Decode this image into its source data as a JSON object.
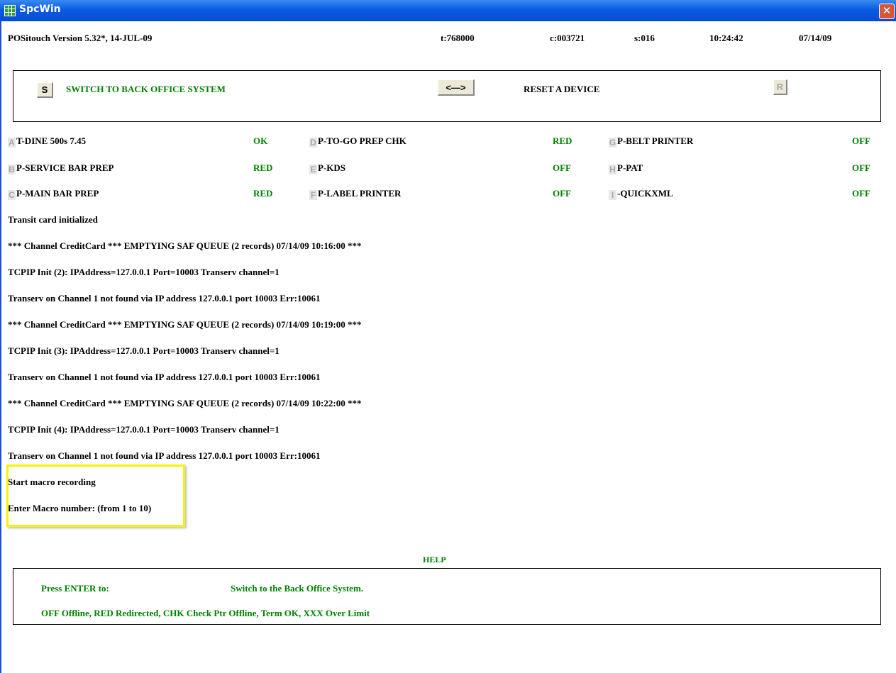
{
  "window": {
    "title": "SpcWin",
    "close": "✕"
  },
  "status": {
    "version": "POSitouch Version 5.32*, 14-JUL-09",
    "t": "t:768000",
    "c": "c:003721",
    "s": "s:016",
    "time": "10:24:42",
    "date": "07/14/09"
  },
  "top_actions": {
    "s_key": "S",
    "switch_label": "SWITCH TO BACK OFFICE SYSTEM",
    "arrow_key": "<—>",
    "reset_label": "RESET A DEVICE",
    "r_key": "R"
  },
  "devices": [
    {
      "key": "A",
      "name": "T-DINE 500s 7.45",
      "status": "OK"
    },
    {
      "key": "B",
      "name": "P-SERVICE BAR PREP",
      "status": "RED"
    },
    {
      "key": "C",
      "name": "P-MAIN BAR PREP",
      "status": "RED"
    },
    {
      "key": "D",
      "name": "P-TO-GO PREP CHK",
      "status": "RED"
    },
    {
      "key": "E",
      "name": "P-KDS",
      "status": "OFF"
    },
    {
      "key": "F",
      "name": "P-LABEL PRINTER",
      "status": "OFF"
    },
    {
      "key": "G",
      "name": "P-BELT PRINTER",
      "status": "OFF"
    },
    {
      "key": "H",
      "name": "P-PAT",
      "status": "OFF"
    },
    {
      "key": "I",
      "name": "-QUICKXML",
      "status": "OFF"
    }
  ],
  "messages": [
    "Transit card initialized",
    "*** Channel CreditCard *** EMPTYING SAF QUEUE (2 records) 07/14/09 10:16:00 ***",
    "TCPIP Init (2): IPAddress=127.0.0.1 Port=10003 Transerv channel=1",
    "Transerv on Channel 1 not found via IP address 127.0.0.1 port 10003 Err:10061",
    "*** Channel CreditCard *** EMPTYING SAF QUEUE (2 records) 07/14/09 10:19:00 ***",
    "TCPIP Init (3): IPAddress=127.0.0.1 Port=10003 Transerv channel=1",
    "Transerv on Channel 1 not found via IP address 127.0.0.1 port 10003 Err:10061",
    "*** Channel CreditCard *** EMPTYING SAF QUEUE (2 records) 07/14/09 10:22:00 ***",
    "TCPIP Init (4): IPAddress=127.0.0.1 Port=10003 Transerv channel=1",
    "Transerv on Channel 1 not found via IP address 127.0.0.1 port 10003 Err:10061",
    "Start macro recording",
    "Enter Macro number: (from 1 to 10)"
  ],
  "help": {
    "title": "HELP",
    "press_enter": "Press ENTER to:",
    "action": "Switch to the Back Office System.",
    "legend": "OFF Offline, RED Redirected, CHK Check Ptr Offline, Term OK, XXX Over Limit"
  },
  "colors": {
    "accent_green": "#008000",
    "titlebar_blue": "#0a5ae2",
    "highlight": "#f5f500"
  }
}
